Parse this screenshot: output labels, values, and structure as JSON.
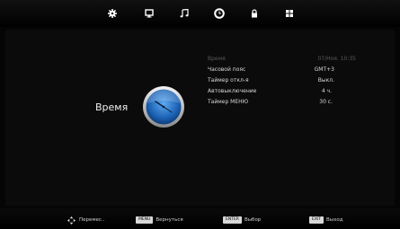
{
  "tabs": [
    {
      "icon": "picture-settings-gear-icon"
    },
    {
      "icon": "screen-monitor-icon"
    },
    {
      "icon": "sound-note-icon"
    },
    {
      "icon": "time-clock-icon",
      "active": true
    },
    {
      "icon": "lock-icon"
    },
    {
      "icon": "setup-grid-icon"
    }
  ],
  "section": {
    "title": "Время"
  },
  "menu": [
    {
      "label": "Время",
      "value": "07/Ноя.   10:35",
      "dim": true
    },
    {
      "label": "Часовой пояс",
      "value": "GMT+3"
    },
    {
      "label": "Таймер откл-я",
      "value": "Выкл."
    },
    {
      "label": "Автовыключение",
      "value": "4 ч."
    },
    {
      "label": "Таймер МЕНЮ",
      "value": "30  с."
    }
  ],
  "hints": {
    "move": "Перемес..",
    "menu_key": "MENU",
    "back": "Вернуться",
    "enter_key": "ENTER",
    "select": "Выбор",
    "exit_key": "EXIT",
    "exit": "Выход"
  },
  "colors": {
    "background": "#050505",
    "accent_clock": "#2a7ccf",
    "text": "#e8e8e8"
  }
}
